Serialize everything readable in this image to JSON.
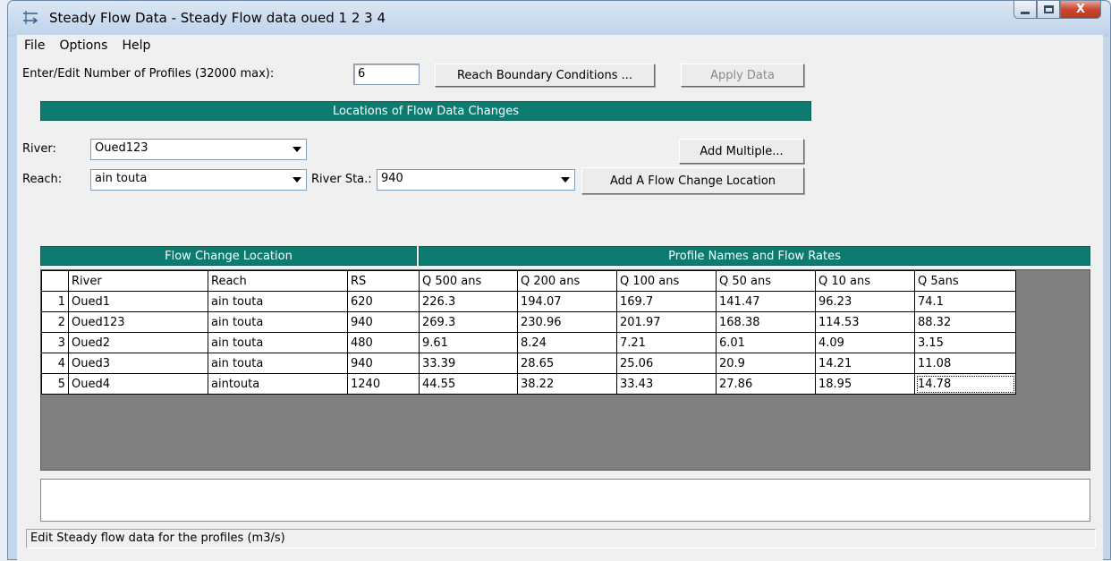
{
  "window": {
    "title": "Steady Flow Data - Steady Flow data oued 1 2 3 4",
    "close_glyph": "X"
  },
  "menu": [
    "File",
    "Options",
    "Help"
  ],
  "profiles": {
    "label": "Enter/Edit Number of Profiles (32000 max):",
    "value": "6",
    "reach_bc_button": "Reach Boundary Conditions ...",
    "apply_button": "Apply Data"
  },
  "locations": {
    "header": "Locations of Flow Data Changes",
    "river_label": "River:",
    "river_value": "Oued123",
    "add_multiple_button": "Add Multiple...",
    "reach_label": "Reach:",
    "reach_value": "ain touta",
    "river_sta_label": "River Sta.:",
    "river_sta_value": "940",
    "add_flow_change_button": "Add A Flow Change Location"
  },
  "grid": {
    "left_header": "Flow Change Location",
    "right_header": "Profile Names and Flow Rates",
    "columns": [
      "River",
      "Reach",
      "RS",
      "Q 500 ans",
      "Q 200 ans",
      "Q  100 ans",
      "Q 50 ans",
      "Q 10 ans",
      "Q 5ans"
    ],
    "rows": [
      {
        "num": "1",
        "cells": [
          "Oued1",
          "ain touta",
          "620",
          "226.3",
          "194.07",
          "169.7",
          "141.47",
          "96.23",
          "74.1"
        ]
      },
      {
        "num": "2",
        "cells": [
          "Oued123",
          "ain touta",
          "940",
          "269.3",
          "230.96",
          "201.97",
          "168.38",
          "114.53",
          "88.32"
        ]
      },
      {
        "num": "3",
        "cells": [
          "Oued2",
          "ain touta",
          "480",
          "9.61",
          "8.24",
          "7.21",
          "6.01",
          "4.09",
          "3.15"
        ]
      },
      {
        "num": "4",
        "cells": [
          "Oued3",
          "ain touta",
          "940",
          "33.39",
          "28.65",
          "25.06",
          "20.9",
          "14.21",
          "11.08"
        ]
      },
      {
        "num": "5",
        "cells": [
          "Oued4",
          "aintouta",
          "1240",
          "44.55",
          "38.22",
          "33.43",
          "27.86",
          "18.95",
          "14.78"
        ]
      }
    ]
  },
  "status": "Edit Steady flow data for the profiles (m3/s)"
}
